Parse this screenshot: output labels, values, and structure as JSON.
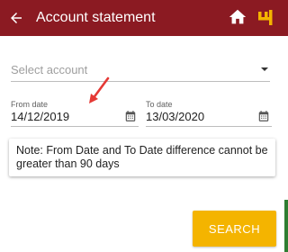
{
  "header": {
    "title": "Account statement",
    "back_icon": "arrow-left-icon",
    "home_icon": "home-icon",
    "logo_icon": "pnb-logo-icon",
    "bar_color": "#8b1a22",
    "logo_color": "#f4b400"
  },
  "account_select": {
    "placeholder": "Select account"
  },
  "from_date": {
    "label": "From date",
    "value": "14/12/2019"
  },
  "to_date": {
    "label": "To date",
    "value": "13/03/2020"
  },
  "note": {
    "text": "Note: From Date and To Date difference cannot be greater than 90 days"
  },
  "search_button": {
    "label": "SEARCH",
    "color": "#f4b400"
  },
  "annotation": {
    "arrow_color": "#e53935"
  }
}
